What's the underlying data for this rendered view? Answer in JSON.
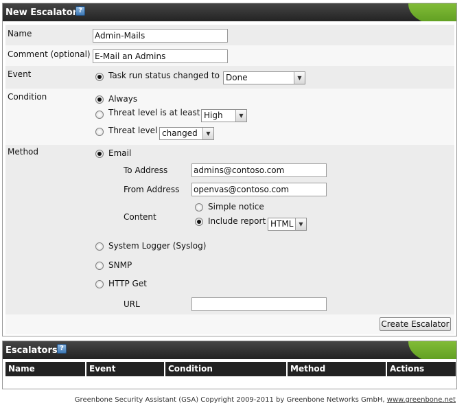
{
  "new_escalator": {
    "title": "New Escalator",
    "help_icon": "?",
    "name_label": "Name",
    "name_value": "Admin-Mails",
    "comment_label": "Comment (optional)",
    "comment_value": "E-Mail an Admins",
    "event_label": "Event",
    "event_option": "Task run status changed to",
    "event_status": "Done",
    "condition_label": "Condition",
    "condition_always": "Always",
    "condition_threat_at_least": "Threat level is at least",
    "condition_threat_at_least_value": "High",
    "condition_threat_level": "Threat level",
    "condition_threat_level_value": "changed",
    "method_label": "Method",
    "method_email": "Email",
    "to_address_label": "To Address",
    "to_address_value": "admins@contoso.com",
    "from_address_label": "From Address",
    "from_address_value": "openvas@contoso.com",
    "content_label": "Content",
    "content_simple_notice": "Simple notice",
    "content_include_report": "Include report",
    "content_report_format": "HTML",
    "method_syslog": "System Logger (Syslog)",
    "method_snmp": "SNMP",
    "method_http_get": "HTTP Get",
    "url_label": "URL",
    "url_value": "",
    "create_button": "Create Escalator",
    "selected": {
      "event": "Task run status changed to",
      "condition": "Always",
      "method": "Email",
      "content": "Include report"
    }
  },
  "escalators": {
    "title": "Escalators",
    "help_icon": "?",
    "columns": [
      "Name",
      "Event",
      "Condition",
      "Method",
      "Actions"
    ],
    "rows": []
  },
  "footer": {
    "copyright": "Greenbone Security Assistant (GSA) Copyright 2009-2011 by Greenbone Networks GmbH,",
    "link": "www.greenbone.net"
  },
  "colors": {
    "header_dark": "#2b2b2b",
    "accent_green": "#7cc23a",
    "row_gray": "#ececec",
    "row_light": "#f7f7f7"
  }
}
